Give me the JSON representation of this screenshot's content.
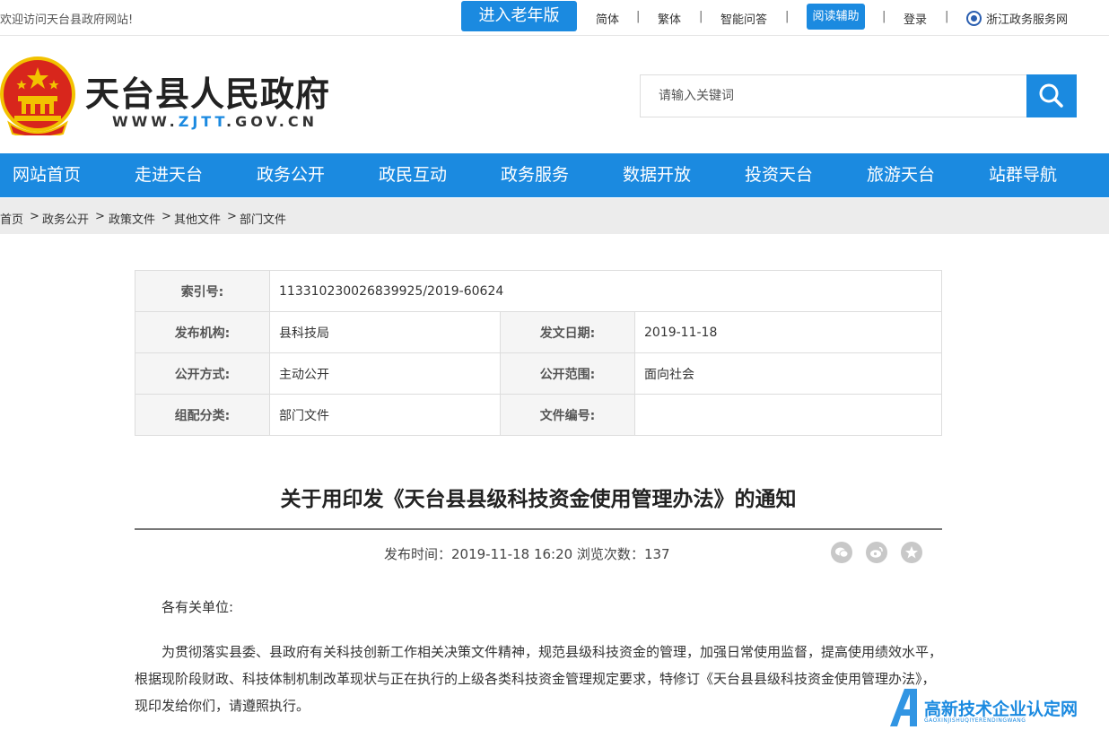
{
  "topbar": {
    "welcome": "欢迎访问天台县政府网站!",
    "elder_mode": "进入老年版",
    "simplified": "简体",
    "traditional": "繁体",
    "qa": "智能问答",
    "reader": "阅读辅助",
    "login": "登录",
    "zj_service": "浙江政务服务网",
    "separator": "|"
  },
  "header": {
    "site_title": "天台县人民政府",
    "url_prefix": "WWW.",
    "url_mid": "ZJTT",
    "url_suffix": ".GOV.CN",
    "search_placeholder": "请输入关键词"
  },
  "nav": [
    "网站首页",
    "走进天台",
    "政务公开",
    "政民互动",
    "政务服务",
    "数据开放",
    "投资天台",
    "旅游天台",
    "站群导航"
  ],
  "breadcrumb": {
    "items": [
      "首页",
      "政务公开",
      "政策文件",
      "其他文件",
      "部门文件"
    ],
    "separator": ">"
  },
  "meta": {
    "index_label": "索引号:",
    "index_value": "11331023002683992​5/2019-60624",
    "org_label": "发布机构:",
    "org_value": "县科技局",
    "date_label": "发文日期:",
    "date_value": "2019-11-18",
    "open_label": "公开方式:",
    "open_value": "主动公开",
    "scope_label": "公开范围:",
    "scope_value": "面向社会",
    "cat_label": "组配分类:",
    "cat_value": "部门文件",
    "docno_label": "文件编号:",
    "docno_value": ""
  },
  "article": {
    "title": "关于用印发《天台县县级科技资金使用管理办法》的通知",
    "publish_time": "发布时间：2019-11-18 16:20    浏览次数：137",
    "salutation": "各有关单位:",
    "paragraph1_line1": "为贯彻落实县委、县政府有关科技创新工作相关决策文件精神，规范县级科技资金的管理，加强日常使用监督，提高使用绩效水平，",
    "paragraph1_line2": "根据现阶段财政、科技体制机制改革现状与正在执行的上级各类科技资金管理规定要求，特修订《天台县县级科技资金使用管理办法》，",
    "paragraph1_line3": "现印发给你们，请遵照执行。"
  },
  "share": [
    "wechat-icon",
    "weibo-icon",
    "favorite-icon"
  ],
  "watermark": {
    "text": "高新技术企业认定网",
    "sub": "GAOXINJISHUQIYERENDINGWANG"
  },
  "colors": {
    "primary": "#1b8ae0",
    "emblem_red": "#d8261c",
    "emblem_gold": "#f2c200"
  }
}
